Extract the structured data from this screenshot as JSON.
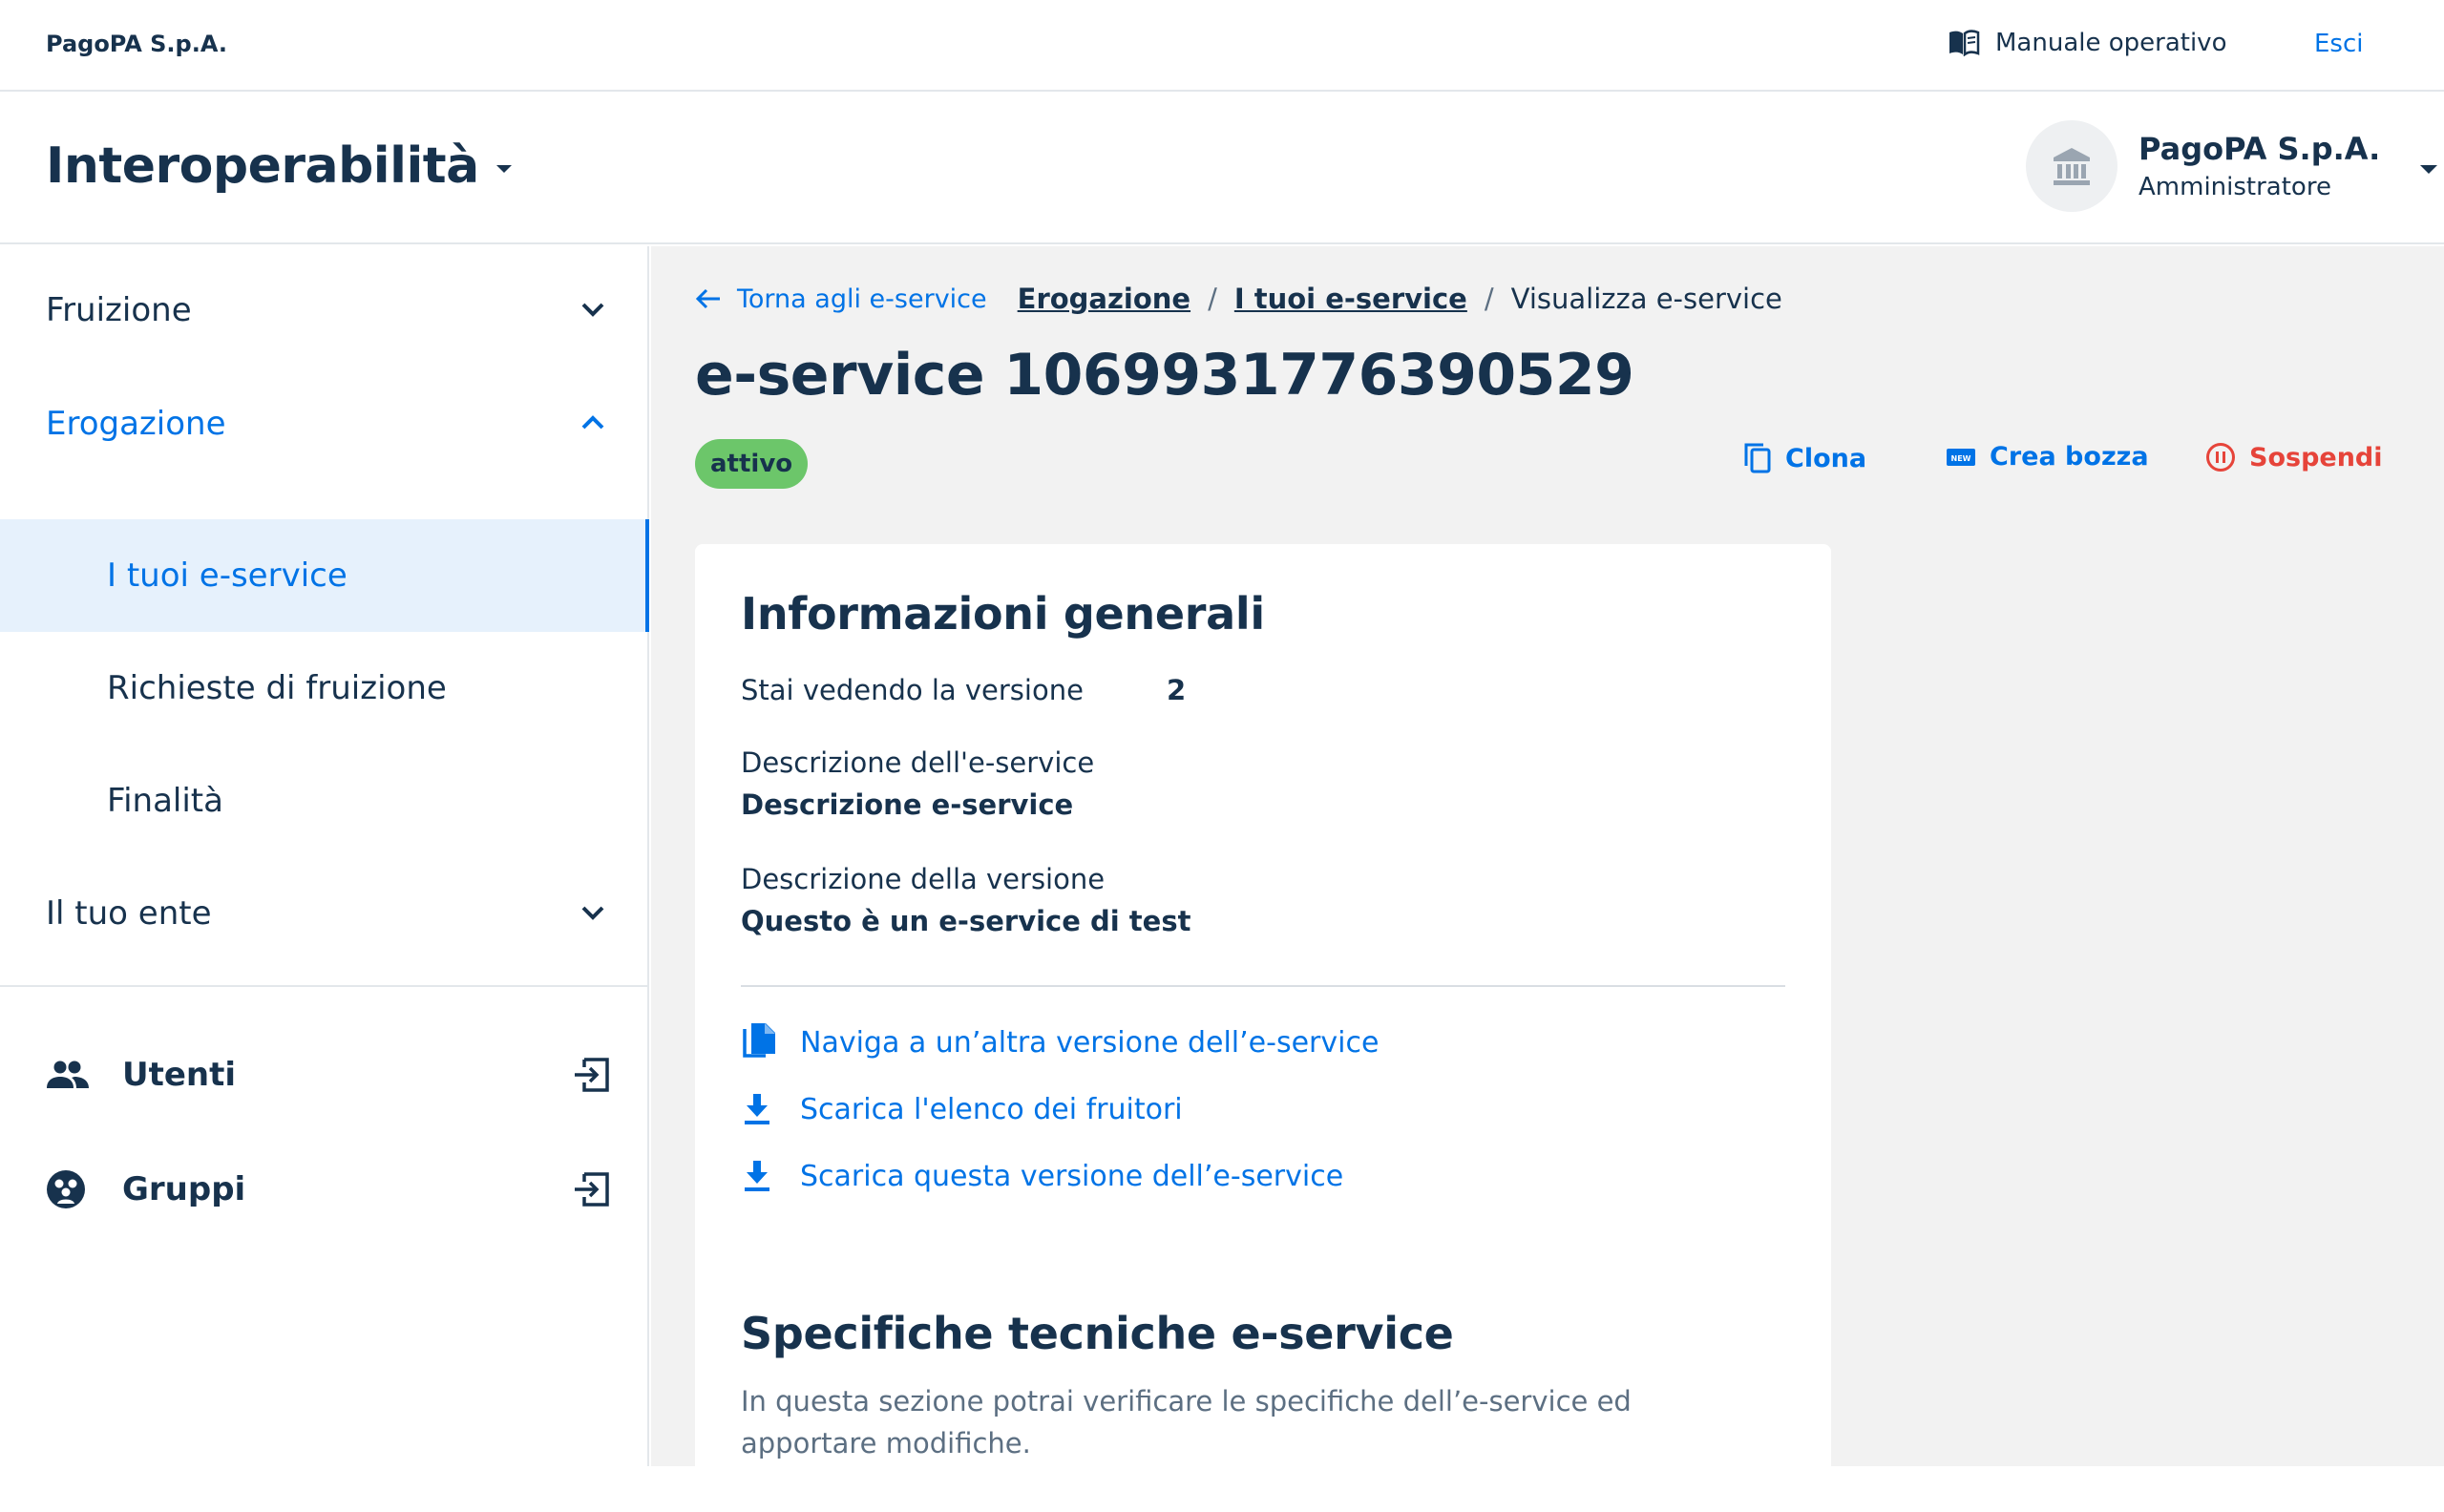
{
  "header": {
    "org_name": "PagoPA S.p.A.",
    "manual_label": "Manuale operativo",
    "logout_label": "Esci"
  },
  "product": {
    "name": "Interoperabilità"
  },
  "account": {
    "name": "PagoPA S.p.A.",
    "role": "Amministratore"
  },
  "sidebar": {
    "groups": [
      {
        "label": "Fruizione",
        "expanded": false
      },
      {
        "label": "Erogazione",
        "expanded": true
      },
      {
        "label": "Il tuo ente",
        "expanded": false
      }
    ],
    "sub_items": [
      {
        "label": "I tuoi e-service",
        "selected": true
      },
      {
        "label": "Richieste di fruizione",
        "selected": false
      },
      {
        "label": "Finalità",
        "selected": false
      }
    ],
    "links": [
      {
        "label": "Utenti",
        "icon": "users-icon"
      },
      {
        "label": "Gruppi",
        "icon": "groups-icon"
      }
    ]
  },
  "breadcrumb": {
    "back_label": "Torna agli e-service",
    "items": [
      "Erogazione",
      "I tuoi e-service"
    ],
    "current": "Visualizza e-service",
    "separator": "/"
  },
  "page": {
    "title": "e-service 1069931776390529",
    "status": "attivo"
  },
  "actions": {
    "clone": "Clona",
    "draft": "Crea bozza",
    "suspend": "Sospendi"
  },
  "general_info": {
    "title": "Informazioni generali",
    "version_label": "Stai vedendo la versione",
    "version_value": "2",
    "description_label": "Descrizione dell'e-service",
    "description_value": "Descrizione e-service",
    "version_desc_label": "Descrizione della versione",
    "version_desc_value": "Questo è un e-service di test",
    "links": [
      {
        "label": "Naviga a un’altra versione dell’e-service",
        "icon": "file-copy-icon"
      },
      {
        "label": "Scarica l'elenco dei fruitori",
        "icon": "download-icon"
      },
      {
        "label": "Scarica questa versione dell’e-service",
        "icon": "download-icon"
      }
    ]
  },
  "tech_specs": {
    "title": "Specifiche tecniche e-service",
    "description": "In questa sezione potrai verificare le specifiche dell’e-service ed apportare modifiche."
  },
  "colors": {
    "primary": "#0073e6",
    "text": "#17324d",
    "danger": "#e6443a",
    "success_badge": "#6cc66a",
    "main_bg": "#f2f2f2"
  }
}
